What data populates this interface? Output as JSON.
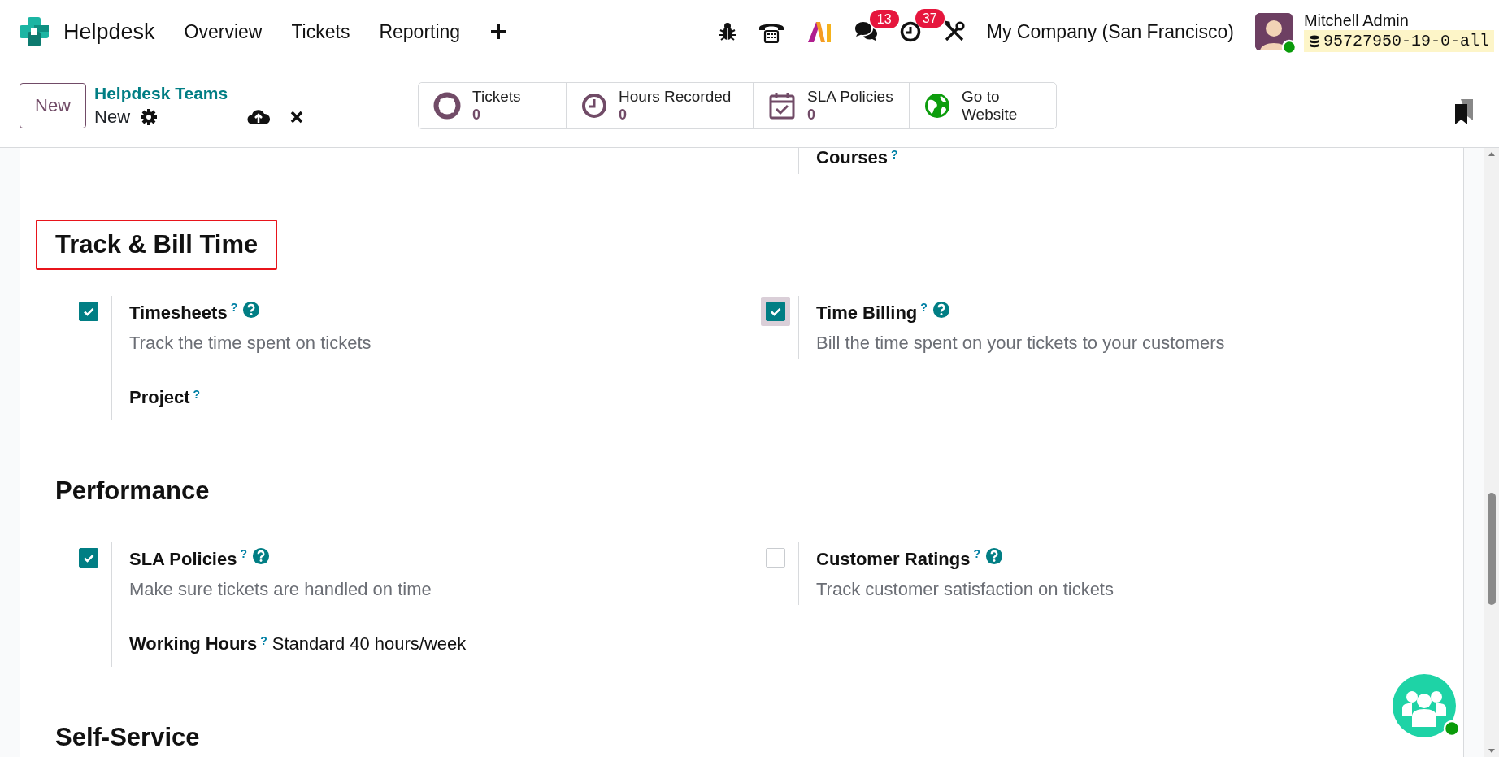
{
  "navbar": {
    "app_name": "Helpdesk",
    "menu": [
      {
        "label": "Overview"
      },
      {
        "label": "Tickets"
      },
      {
        "label": "Reporting"
      }
    ],
    "badges": {
      "messages": "13",
      "activities": "37"
    },
    "company": "My Company (San Francisco)",
    "user": {
      "name": "Mitchell Admin",
      "database": "95727950-19-0-all",
      "online": true
    }
  },
  "control_panel": {
    "new_button": "New",
    "breadcrumb": "Helpdesk Teams",
    "record": "New",
    "smart_buttons": [
      {
        "label": "Tickets",
        "value": "0"
      },
      {
        "label": "Hours Recorded",
        "value": "0"
      },
      {
        "label": "SLA Policies",
        "value": "0"
      },
      {
        "label": "Go to Website"
      }
    ]
  },
  "previous_section": {
    "right_fields": [
      {
        "label": "Courses",
        "mark": "?"
      }
    ]
  },
  "sections": [
    {
      "title": "Track & Bill Time",
      "highlighted": true,
      "settings": [
        {
          "title": "Timesheets",
          "mark": "?",
          "help": true,
          "checked": true,
          "focused": false,
          "description": "Track the time spent on tickets",
          "fields": [
            {
              "label": "Project",
              "mark": "?"
            }
          ]
        },
        {
          "title": "Time Billing",
          "mark": "?",
          "help": true,
          "checked": true,
          "focused": true,
          "description": "Bill the time spent on your tickets to your customers"
        }
      ]
    },
    {
      "title": "Performance",
      "highlighted": false,
      "settings": [
        {
          "title": "SLA Policies",
          "mark": "?",
          "help": true,
          "checked": true,
          "focused": false,
          "description": "Make sure tickets are handled on time",
          "fields": [
            {
              "label": "Working Hours",
              "mark": "?",
              "value": "Standard 40 hours/week"
            }
          ]
        },
        {
          "title": "Customer Ratings",
          "mark": "?",
          "help": true,
          "checked": false,
          "focused": false,
          "description": "Track customer satisfaction on tickets"
        }
      ]
    },
    {
      "title": "Self-Service",
      "highlighted": false
    }
  ],
  "chat_button": {
    "online": true
  }
}
